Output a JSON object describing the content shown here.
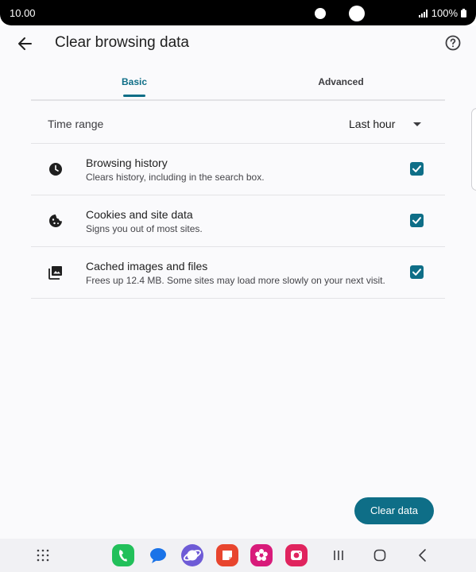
{
  "status": {
    "time": "10.00",
    "battery": "100%"
  },
  "header": {
    "title": "Clear browsing data"
  },
  "tabs": [
    {
      "label": "Basic"
    },
    {
      "label": "Advanced"
    }
  ],
  "time_range": {
    "label": "Time range",
    "value": "Last hour"
  },
  "options": [
    {
      "title": "Browsing history",
      "subtitle": "Clears history, including in the search box.",
      "icon": "clock-icon",
      "checked": true
    },
    {
      "title": "Cookies and site data",
      "subtitle": "Signs you out of most sites.",
      "icon": "cookie-icon",
      "checked": true
    },
    {
      "title": "Cached images and files",
      "subtitle": "Frees up 12.4 MB. Some sites may load more slowly on your next visit.",
      "icon": "image-icon",
      "checked": true
    }
  ],
  "actions": {
    "clear_label": "Clear data"
  },
  "colors": {
    "accent": "#0e6e87"
  }
}
